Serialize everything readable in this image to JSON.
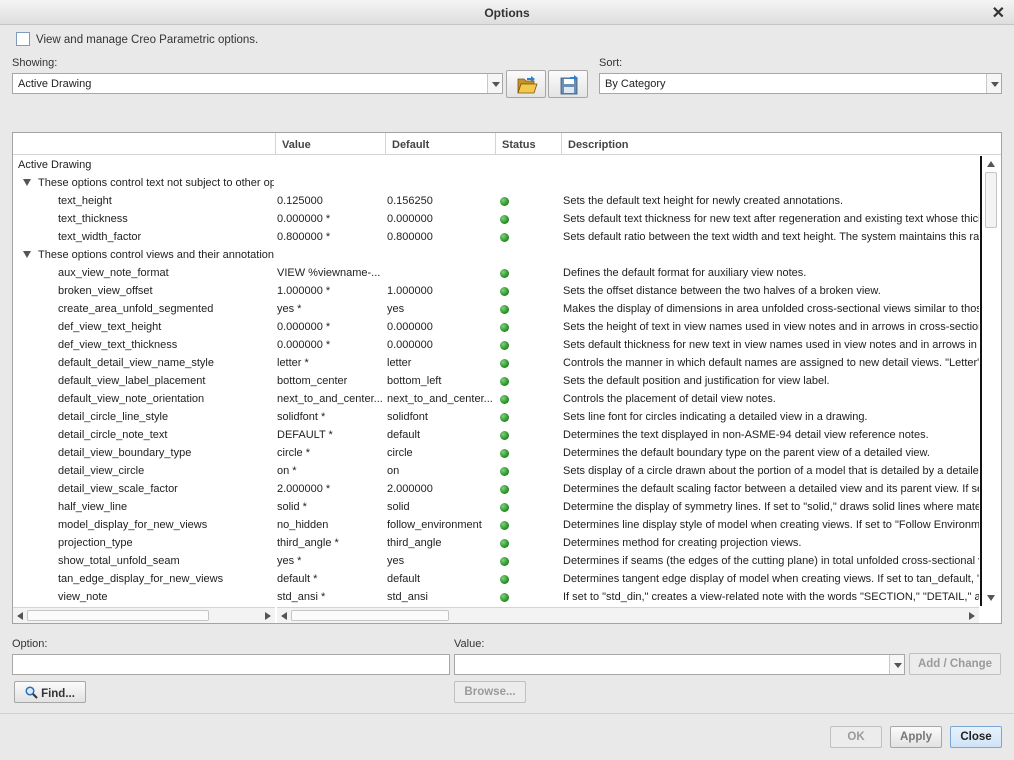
{
  "window": {
    "title": "Options"
  },
  "header": {
    "checkbox_label": "View and manage Creo Parametric options."
  },
  "showing": {
    "label": "Showing:",
    "value": "Active Drawing"
  },
  "sort": {
    "label": "Sort:",
    "value": "By Category"
  },
  "table": {
    "columns": {
      "name": "",
      "value": "Value",
      "default": "Default",
      "status": "Status",
      "description": "Description"
    },
    "root_label": "Active Drawing",
    "groups": [
      {
        "label": "These options control text not subject to other options",
        "rows": [
          {
            "name": "text_height",
            "value": "0.125000",
            "default": "0.156250",
            "desc": "Sets the default text height for newly created annotations."
          },
          {
            "name": "text_thickness",
            "value": "0.000000 *",
            "default": "0.000000",
            "desc": "Sets default text thickness for new text after regeneration and existing text whose thickness has not been modified."
          },
          {
            "name": "text_width_factor",
            "value": "0.800000 *",
            "default": "0.800000",
            "desc": "Sets default ratio between the text width and text height. The system maintains this ratio until you change it."
          }
        ]
      },
      {
        "label": "These options control views and their annotations",
        "rows": [
          {
            "name": "aux_view_note_format",
            "value": "VIEW %viewname-...",
            "default": "",
            "desc": "Defines the default format for auxiliary view notes."
          },
          {
            "name": "broken_view_offset",
            "value": "1.000000 *",
            "default": "1.000000",
            "desc": "Sets the offset distance between the two halves of a broken view."
          },
          {
            "name": "create_area_unfold_segmented",
            "value": "yes *",
            "default": "yes",
            "desc": "Makes the display of dimensions in area unfolded cross-sectional views similar to those in total unfolded views."
          },
          {
            "name": "def_view_text_height",
            "value": "0.000000 *",
            "default": "0.000000",
            "desc": "Sets the height of text in view names used in view notes and in arrows in cross-section views."
          },
          {
            "name": "def_view_text_thickness",
            "value": "0.000000 *",
            "default": "0.000000",
            "desc": "Sets default thickness for new text in view names used in view notes and in arrows in cross-section views."
          },
          {
            "name": "default_detail_view_name_style",
            "value": "letter *",
            "default": "letter",
            "desc": "Controls the manner in which default names are assigned to new detail views. \"Letter\" uses letters."
          },
          {
            "name": "default_view_label_placement",
            "value": "bottom_center",
            "default": "bottom_left",
            "desc": "Sets the default position and justification for view label."
          },
          {
            "name": "default_view_note_orientation",
            "value": "next_to_and_center...",
            "default": "next_to_and_center...",
            "desc": "Controls the placement of detail view notes."
          },
          {
            "name": "detail_circle_line_style",
            "value": "solidfont *",
            "default": "solidfont",
            "desc": "Sets line font for circles indicating a detailed view in a drawing."
          },
          {
            "name": "detail_circle_note_text",
            "value": "DEFAULT *",
            "default": "default",
            "desc": "Determines the text displayed in non-ASME-94 detail view reference notes."
          },
          {
            "name": "detail_view_boundary_type",
            "value": "circle *",
            "default": "circle",
            "desc": "Determines the default boundary type on the parent view of a detailed view."
          },
          {
            "name": "detail_view_circle",
            "value": "on *",
            "default": "on",
            "desc": "Sets display of a circle drawn about the portion of a model that is detailed by a detailed view."
          },
          {
            "name": "detail_view_scale_factor",
            "value": "2.000000 *",
            "default": "2.000000",
            "desc": "Determines the default scaling factor between a detailed view and its parent view. If set to zero..."
          },
          {
            "name": "half_view_line",
            "value": "solid *",
            "default": "solid",
            "desc": "Determine the display of symmetry lines. If set to \"solid,\" draws solid lines where material is removed."
          },
          {
            "name": "model_display_for_new_views",
            "value": "no_hidden",
            "default": "follow_environment",
            "desc": "Determines line display style of model when creating views. If set to \"Follow Environment\"..."
          },
          {
            "name": "projection_type",
            "value": "third_angle *",
            "default": "third_angle",
            "desc": "Determines method for creating projection views."
          },
          {
            "name": "show_total_unfold_seam",
            "value": "yes *",
            "default": "yes",
            "desc": "Determines if seams (the edges of the cutting plane) in total unfolded cross-sectional views are shown."
          },
          {
            "name": "tan_edge_display_for_new_views",
            "value": "default *",
            "default": "default",
            "desc": "Determines tangent edge display of model when creating views. If set to tan_default, \"...\""
          },
          {
            "name": "view_note",
            "value": "std_ansi *",
            "default": "std_ansi",
            "desc": "If set to \"std_din,\" creates a view-related note with the words \"SECTION,\" \"DETAIL,\" and so on."
          }
        ]
      }
    ]
  },
  "option_field": {
    "label": "Option:",
    "value": ""
  },
  "value_field": {
    "label": "Value:",
    "value": ""
  },
  "buttons": {
    "add_change": "Add / Change",
    "find": "Find...",
    "browse": "Browse...",
    "ok": "OK",
    "apply": "Apply",
    "close": "Close"
  },
  "icons": {
    "close": "close-icon",
    "open_folder": "folder-open-icon",
    "save": "save-icon",
    "find": "magnifier-icon",
    "status": "status-dot-icon"
  },
  "colors": {
    "status_green": "#2a9a2a",
    "close_accent": "#cfe3f7"
  }
}
